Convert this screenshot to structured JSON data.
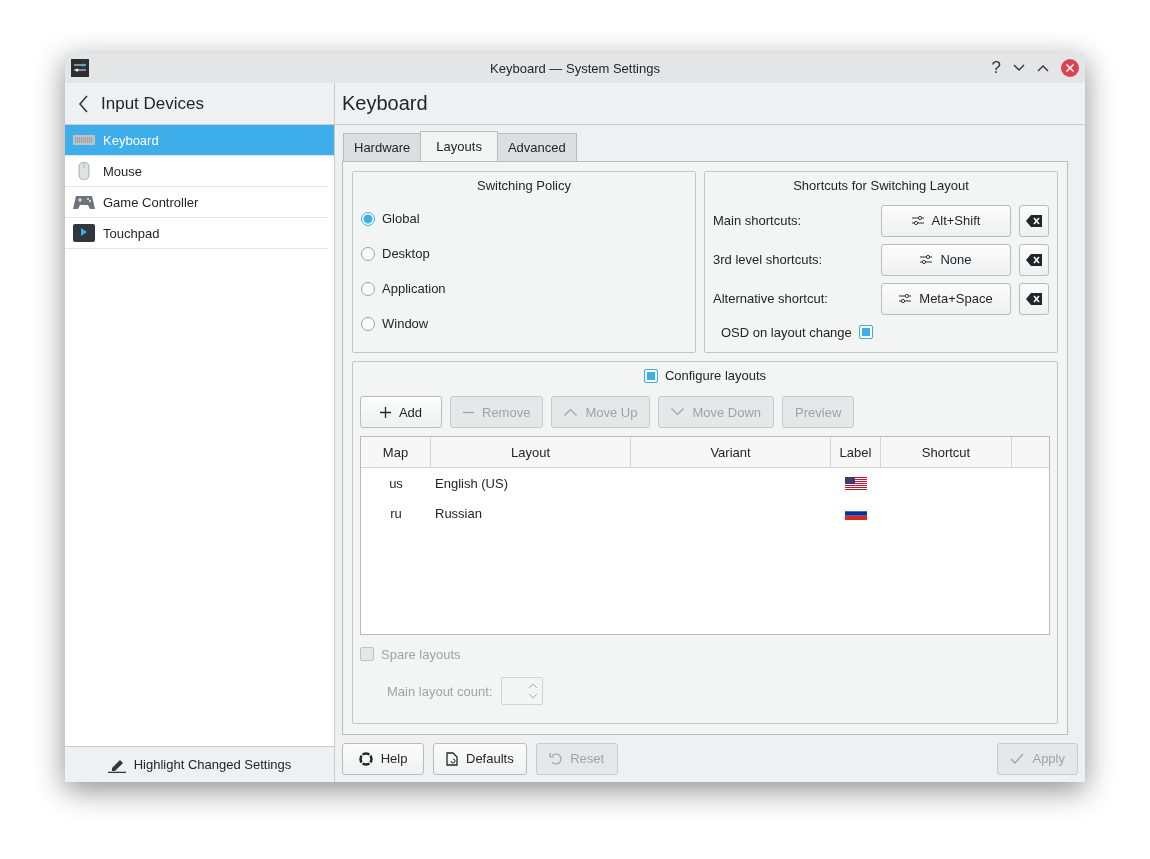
{
  "window": {
    "title": "Keyboard — System Settings",
    "help": "?"
  },
  "sidebar": {
    "back_title": "Input Devices",
    "items": [
      {
        "label": "Keyboard",
        "kind": "keyboard",
        "selected": true
      },
      {
        "label": "Mouse",
        "kind": "mouse",
        "selected": false
      },
      {
        "label": "Game Controller",
        "kind": "gamepad",
        "selected": false
      },
      {
        "label": "Touchpad",
        "kind": "touchpad",
        "selected": false
      }
    ],
    "footer_button": "Highlight Changed Settings"
  },
  "page_title": "Keyboard",
  "tabs": [
    {
      "label": "Hardware",
      "selected": false
    },
    {
      "label": "Layouts",
      "selected": true
    },
    {
      "label": "Advanced",
      "selected": false
    }
  ],
  "switching_policy": {
    "title": "Switching Policy",
    "options": [
      {
        "label": "Global",
        "selected": true
      },
      {
        "label": "Desktop",
        "selected": false
      },
      {
        "label": "Application",
        "selected": false
      },
      {
        "label": "Window",
        "selected": false
      }
    ]
  },
  "shortcuts": {
    "title": "Shortcuts for Switching Layout",
    "rows": [
      {
        "label": "Main shortcuts:",
        "value": "Alt+Shift"
      },
      {
        "label": "3rd level shortcuts:",
        "value": "None"
      },
      {
        "label": "Alternative shortcut:",
        "value": "Meta+Space"
      }
    ],
    "osd": {
      "label": "OSD on layout change",
      "checked": true
    }
  },
  "layouts": {
    "configure": {
      "label": "Configure layouts",
      "checked": true
    },
    "buttons": [
      {
        "label": "Add",
        "kind": "add",
        "disabled": false
      },
      {
        "label": "Remove",
        "kind": "remove",
        "disabled": true
      },
      {
        "label": "Move Up",
        "kind": "up",
        "disabled": true
      },
      {
        "label": "Move Down",
        "kind": "down",
        "disabled": true
      },
      {
        "label": "Preview",
        "kind": "none",
        "disabled": true
      }
    ],
    "columns": [
      "Map",
      "Layout",
      "Variant",
      "Label",
      "Shortcut"
    ],
    "rows": [
      {
        "map": "us",
        "layout": "English (US)",
        "kind": "us"
      },
      {
        "map": "ru",
        "layout": "Russian",
        "kind": "ru"
      }
    ],
    "spare": {
      "label": "Spare layouts",
      "checked": false,
      "disabled": true
    },
    "count_label": "Main layout count:"
  },
  "footer_buttons": [
    {
      "label": "Help",
      "kind": "help",
      "disabled": false
    },
    {
      "label": "Defaults",
      "kind": "defaults",
      "disabled": false
    },
    {
      "label": "Reset",
      "kind": "reset",
      "disabled": true
    },
    {
      "label": "Apply",
      "kind": "apply",
      "disabled": true
    }
  ]
}
